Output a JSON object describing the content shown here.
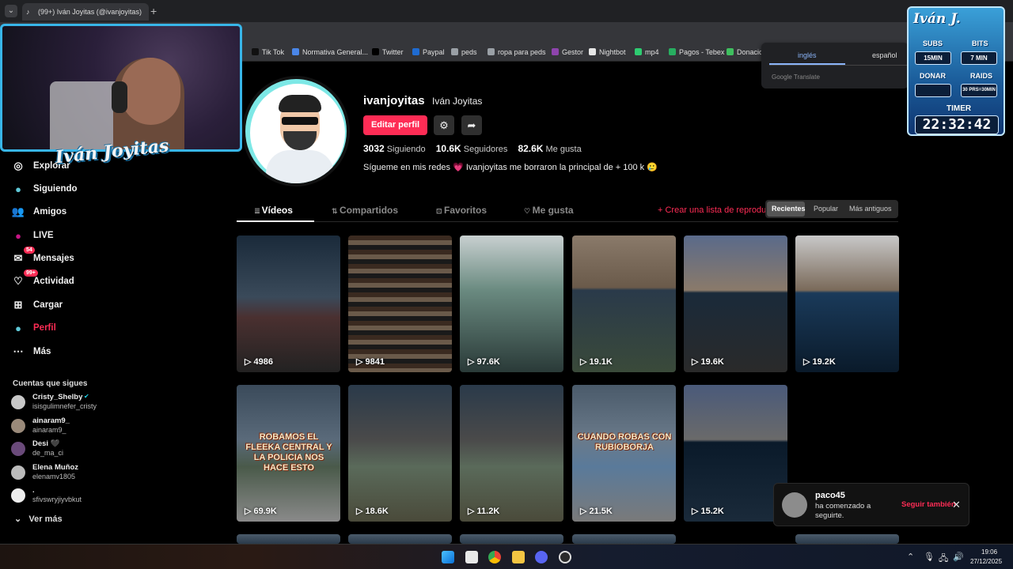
{
  "browser": {
    "tab_title": "(99+) Iván Joyitas (@ivanjoyitas)",
    "bookmarks": [
      {
        "label": "Tik Tok",
        "color": "#111111"
      },
      {
        "label": "Normativa General...",
        "color": "#4a86e8"
      },
      {
        "label": "Twitter",
        "color": "#000000"
      },
      {
        "label": "Paypal",
        "color": "#1f6bd1"
      },
      {
        "label": "peds",
        "color": "#9aa0a6"
      },
      {
        "label": "ropa para peds",
        "color": "#9aa0a6"
      },
      {
        "label": "Gestor",
        "color": "#8e44ad"
      },
      {
        "label": "Nightbot",
        "color": "#e6e6e6"
      },
      {
        "label": "mp4",
        "color": "#2ecc71"
      },
      {
        "label": "Pagos - Tebex",
        "color": "#27ae60"
      },
      {
        "label": "Donacio",
        "color": "#3fbf5f"
      }
    ]
  },
  "translate": {
    "lang_en": "inglés",
    "lang_es": "español",
    "by": "Google Translate"
  },
  "webcam": {
    "name_overlay": "Iván Joyitas"
  },
  "widget": {
    "title": "Iván J.",
    "subs_label": "SUBS",
    "subs_value": "15MIN",
    "bits_label": "BITS",
    "bits_value": "7 MIN",
    "donar_label": "DONAR",
    "donar_value": "",
    "raids_label": "RAIDS",
    "raids_value": "30 PRS=30MIN",
    "timer_label": "TIMER",
    "timer_value": "22:32:42"
  },
  "sidebar": {
    "items": [
      {
        "label": "Explorar",
        "icon": "compass-icon"
      },
      {
        "label": "Siguiendo",
        "icon": "following-avatar-icon"
      },
      {
        "label": "Amigos",
        "icon": "friends-icon"
      },
      {
        "label": "LIVE",
        "icon": "live-icon"
      },
      {
        "label": "Mensajes",
        "icon": "messages-icon",
        "badge": "54"
      },
      {
        "label": "Actividad",
        "icon": "activity-icon",
        "badge": "99+"
      },
      {
        "label": "Cargar",
        "icon": "upload-icon"
      },
      {
        "label": "Perfil",
        "icon": "profile-icon",
        "active": true
      },
      {
        "label": "Más",
        "icon": "more-icon"
      }
    ],
    "following_heading": "Cuentas que sigues",
    "accounts": [
      {
        "name": "Cristy_Shelby",
        "handle": "isisgulimnefer_cristy",
        "verified": true
      },
      {
        "name": "ainaram9_",
        "handle": "ainaram9_"
      },
      {
        "name": "Desi 🖤",
        "handle": "de_ma_ci"
      },
      {
        "name": "Elena Muñoz",
        "handle": "elenamv1805"
      },
      {
        "name": ".",
        "handle": "sfivswryjiyvbkut"
      }
    ],
    "see_more": "Ver más"
  },
  "profile": {
    "username": "ivanjoyitas",
    "nickname": "Iván Joyitas",
    "edit_label": "Editar perfil",
    "following_count": "3032",
    "following_label": "Siguiendo",
    "followers_count": "10.6K",
    "followers_label": "Seguidores",
    "likes_count": "82.6K",
    "likes_label": "Me gusta",
    "bio": "Sígueme en mis redes 💗 Ivanjoyitas me borraron la principal de + 100 k 🥲"
  },
  "tabs": [
    {
      "label": "Vídeos",
      "icon": "grid-icon",
      "active": true
    },
    {
      "label": "Compartidos",
      "icon": "repost-icon"
    },
    {
      "label": "Favoritos",
      "icon": "bookmark-icon"
    },
    {
      "label": "Me gusta",
      "icon": "heart-icon"
    }
  ],
  "create_playlist": "Crear una lista de reproducción",
  "sort": {
    "recent": "Recientes",
    "popular": "Popular",
    "oldest": "Más antiguos"
  },
  "videos": [
    {
      "views": "4986",
      "caption": ""
    },
    {
      "views": "9841",
      "caption": ""
    },
    {
      "views": "97.6K",
      "caption": ""
    },
    {
      "views": "19.1K",
      "caption": ""
    },
    {
      "views": "19.6K",
      "caption": ""
    },
    {
      "views": "19.2K",
      "caption": ""
    },
    {
      "views": "69.9K",
      "caption": "ROBAMOS EL FLEEKA CENTRAL Y LA POLICIA NOS HACE ESTO"
    },
    {
      "views": "18.6K",
      "caption": ""
    },
    {
      "views": "11.2K",
      "caption": ""
    },
    {
      "views": "21.5K",
      "caption": "CUANDO ROBAS CON RUBIOBORJA"
    },
    {
      "views": "15.2K",
      "caption": ""
    }
  ],
  "toast": {
    "user": "paco45",
    "message": "ha comenzado a seguirte.",
    "follow_back": "Seguir también"
  },
  "taskbar": {
    "time": "19:06",
    "date": "27/12/2025"
  }
}
